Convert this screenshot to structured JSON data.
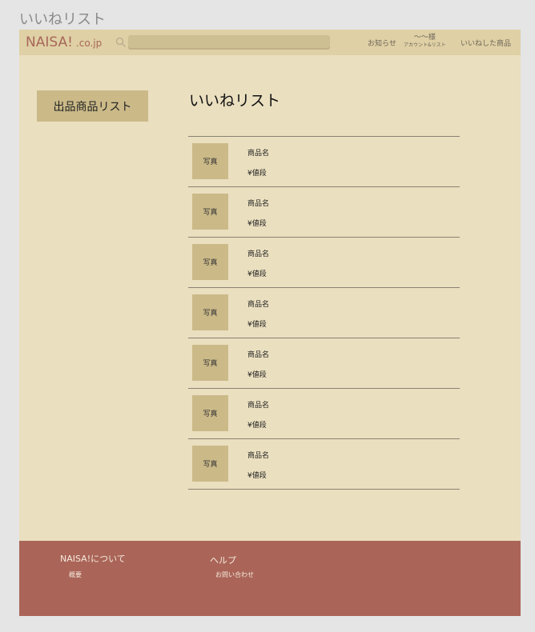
{
  "frame_title": "いいねリスト",
  "header": {
    "logo_main": "NAISA!",
    "logo_tld": ".co.jp",
    "search_placeholder": "",
    "nav_notice": "お知らせ",
    "nav_account_name": "〜〜様",
    "nav_account_sub": "アカウント&リスト",
    "nav_liked": "いいねした商品"
  },
  "sidebar": {
    "button_label": "出品商品リスト"
  },
  "main": {
    "title": "いいねリスト",
    "items": [
      {
        "photo": "写真",
        "name": "商品名",
        "price": "¥値段"
      },
      {
        "photo": "写真",
        "name": "商品名",
        "price": "¥値段"
      },
      {
        "photo": "写真",
        "name": "商品名",
        "price": "¥値段"
      },
      {
        "photo": "写真",
        "name": "商品名",
        "price": "¥値段"
      },
      {
        "photo": "写真",
        "name": "商品名",
        "price": "¥値段"
      },
      {
        "photo": "写真",
        "name": "商品名",
        "price": "¥値段"
      },
      {
        "photo": "写真",
        "name": "商品名",
        "price": "¥値段"
      }
    ]
  },
  "footer": {
    "about_heading": "NAISA!について",
    "about_link": "概要",
    "help_heading": "ヘルプ",
    "help_link": "お問い合わせ"
  },
  "colors": {
    "page_bg": "#eadfbf",
    "header_bg": "#dfd0a5",
    "accent_tan": "#cbba88",
    "footer_bg": "#aa6558",
    "logo": "#a8675a"
  }
}
